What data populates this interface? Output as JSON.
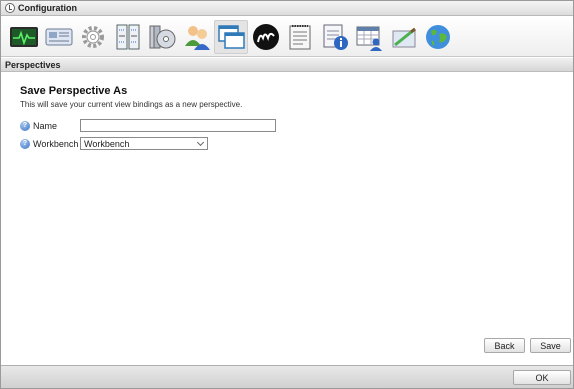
{
  "window": {
    "title": "Configuration"
  },
  "toolbar": {
    "items": [
      {
        "icon": "monitor-pulse-icon"
      },
      {
        "icon": "id-card-icon"
      },
      {
        "icon": "gear-icon"
      },
      {
        "icon": "server-icon"
      },
      {
        "icon": "disc-folder-icon"
      },
      {
        "icon": "users-icon"
      },
      {
        "icon": "windows-icon",
        "active": true
      },
      {
        "icon": "logo-m-icon"
      },
      {
        "icon": "notepad-icon"
      },
      {
        "icon": "calendar-user-icon"
      },
      {
        "icon": "checklist-pen-icon"
      },
      {
        "icon": "globe-icon"
      }
    ]
  },
  "section": {
    "title": "Perspectives"
  },
  "form": {
    "title": "Save Perspective As",
    "description": "This will save your current view bindings as a new perspective.",
    "name_label": "Name",
    "name_value": "",
    "workbench_label": "Workbench",
    "workbench_value": "Workbench"
  },
  "buttons": {
    "back": "Back",
    "save": "Save",
    "ok": "OK"
  },
  "colors": {
    "accent_help": "#3d74c4",
    "active_tool_bg": "#e4e4e4"
  }
}
